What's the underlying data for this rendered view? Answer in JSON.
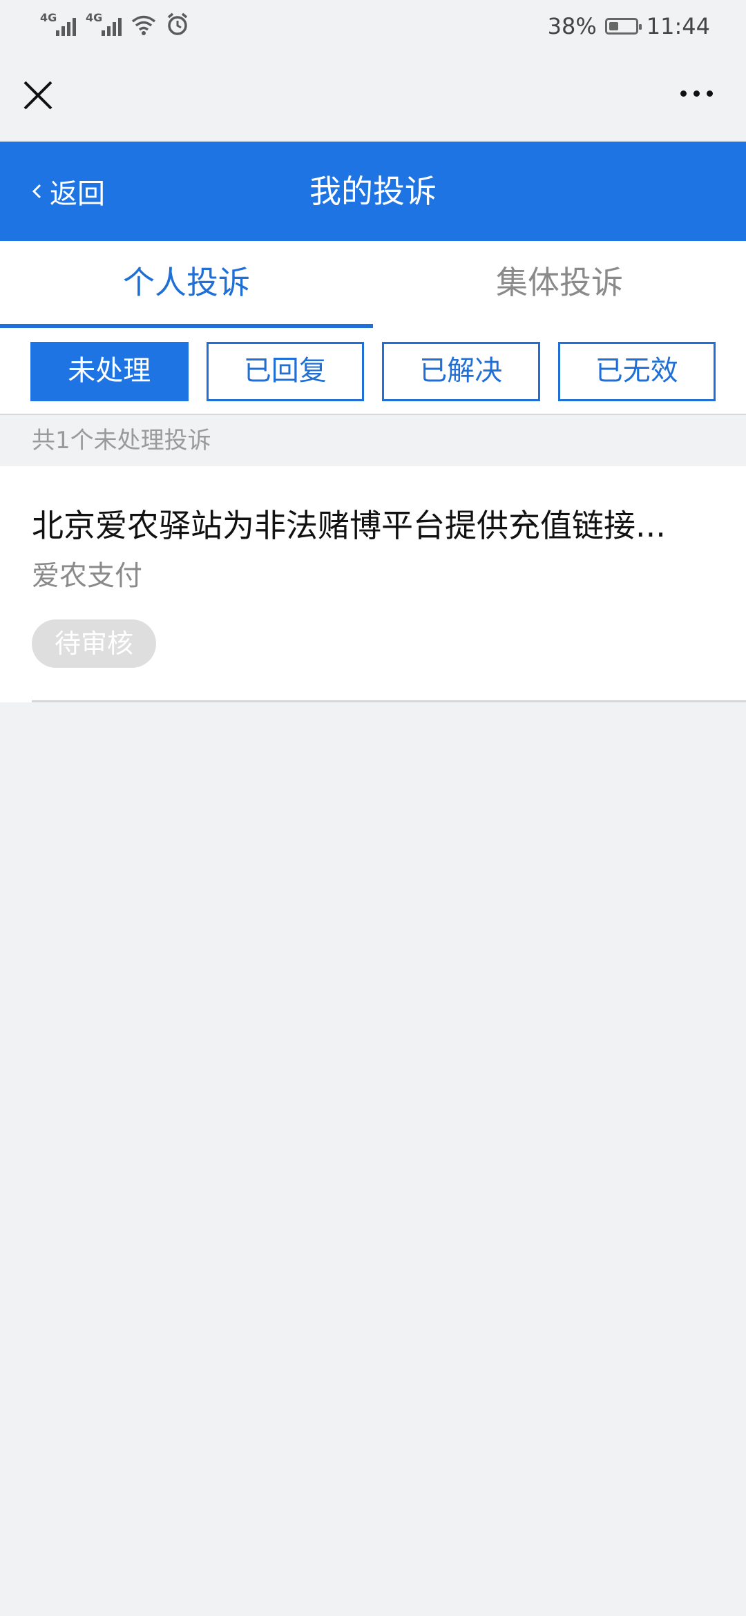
{
  "status_bar": {
    "signal1_tag": "4G",
    "signal2_tag": "4G",
    "battery_percent": "38%",
    "battery_level": 0.38,
    "time": "11:44"
  },
  "header": {
    "back_label": "返回",
    "title": "我的投诉"
  },
  "tabs": [
    {
      "label": "个人投诉",
      "active": true
    },
    {
      "label": "集体投诉",
      "active": false
    }
  ],
  "filters": [
    {
      "label": "未处理",
      "active": true
    },
    {
      "label": "已回复",
      "active": false
    },
    {
      "label": "已解决",
      "active": false
    },
    {
      "label": "已无效",
      "active": false
    }
  ],
  "summary": {
    "count_text": "共1个未处理投诉"
  },
  "complaints": [
    {
      "title": "北京爱农驿站为非法赌博平台提供充值链接...",
      "merchant": "爱农支付",
      "status": "待审核"
    }
  ],
  "colors": {
    "primary": "#1f74e4",
    "tab_active": "#1f6fd6",
    "background": "#f1f2f4",
    "badge_bg": "#dedede"
  }
}
